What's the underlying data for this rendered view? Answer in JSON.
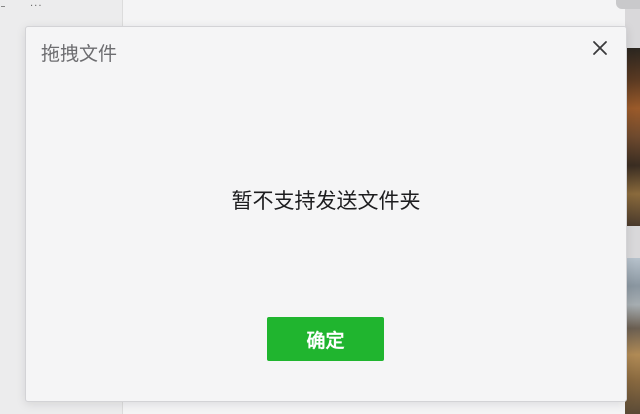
{
  "background_window": {
    "menu_dots": "···"
  },
  "dialog": {
    "title": "拖拽文件",
    "close_icon": "close-icon",
    "message": "暂不支持发送文件夹",
    "confirm_label": "确定",
    "confirm_color": "#20b52f"
  }
}
